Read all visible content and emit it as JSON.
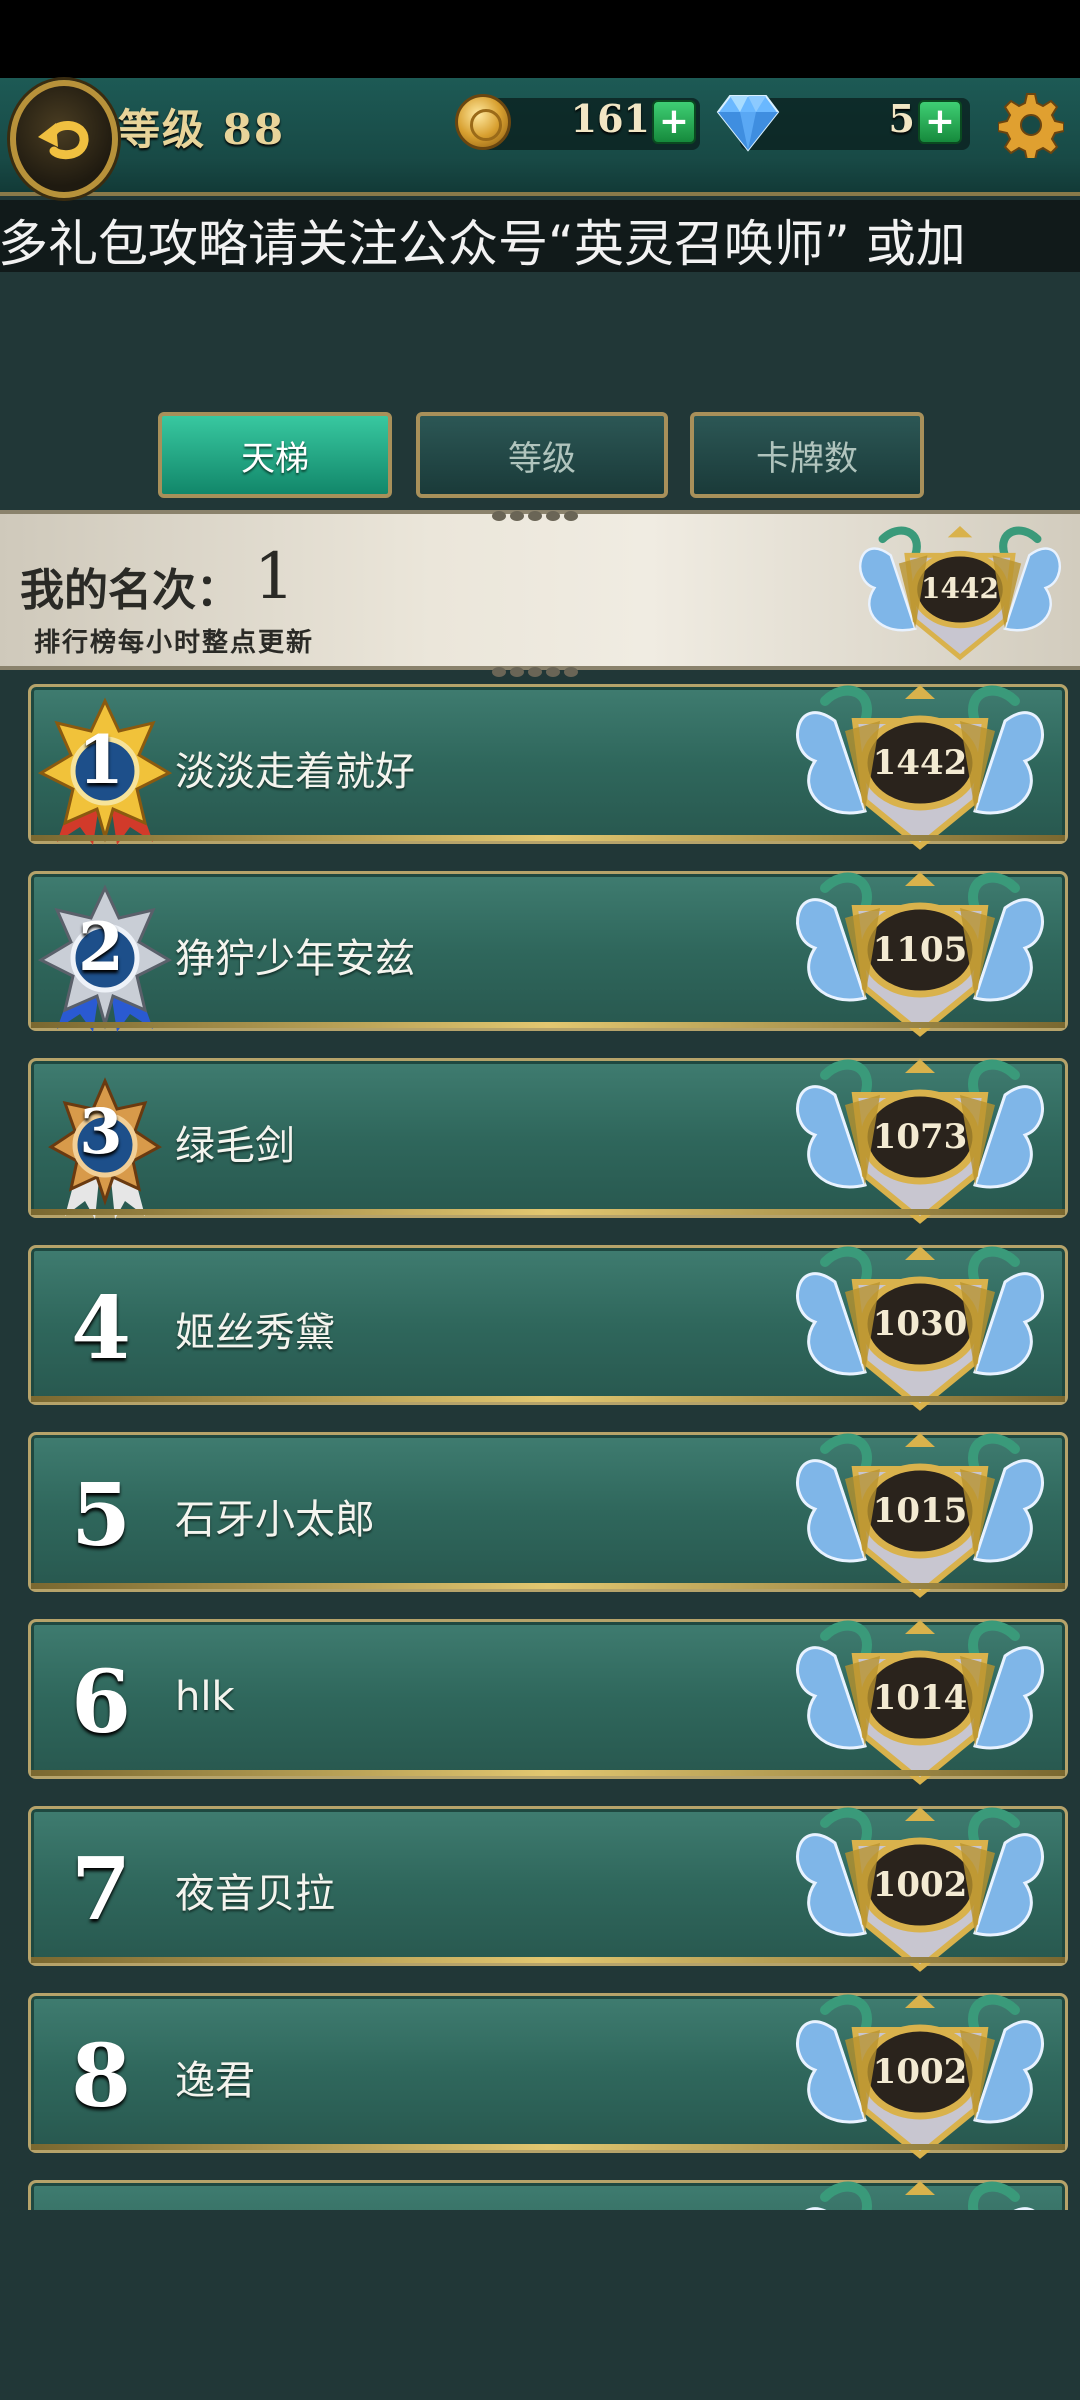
{
  "header": {
    "level_label": "等级 88",
    "coins": "161",
    "gems": "5"
  },
  "marquee": "多礼包攻略请关注公众号“英灵召唤师” 或加",
  "tabs": [
    {
      "label": "天梯",
      "active": true
    },
    {
      "label": "等级",
      "active": false
    },
    {
      "label": "卡牌数",
      "active": false
    }
  ],
  "my_rank": {
    "label": "我的名次：",
    "value": "1",
    "note": "排行榜每小时整点更新",
    "score": "1442"
  },
  "leaderboard": [
    {
      "rank": "1",
      "name": "淡淡走着就好",
      "score": "1442",
      "medal": "gold"
    },
    {
      "rank": "2",
      "name": "狰狞少年安兹",
      "score": "1105",
      "medal": "silver"
    },
    {
      "rank": "3",
      "name": "绿毛剑",
      "score": "1073",
      "medal": "bronze"
    },
    {
      "rank": "4",
      "name": "姬丝秀黛",
      "score": "1030"
    },
    {
      "rank": "5",
      "name": "石牙小太郎",
      "score": "1015"
    },
    {
      "rank": "6",
      "name": "hlk",
      "score": "1014"
    },
    {
      "rank": "7",
      "name": "夜音贝拉",
      "score": "1002"
    },
    {
      "rank": "8",
      "name": "逸君",
      "score": "1002"
    },
    {
      "rank": "",
      "name": "",
      "score": ""
    }
  ],
  "colors": {
    "background": "#213737",
    "row_green": "#2f675c",
    "gold_trim": "#b6a36a",
    "tab_active": "#1fa07e"
  }
}
